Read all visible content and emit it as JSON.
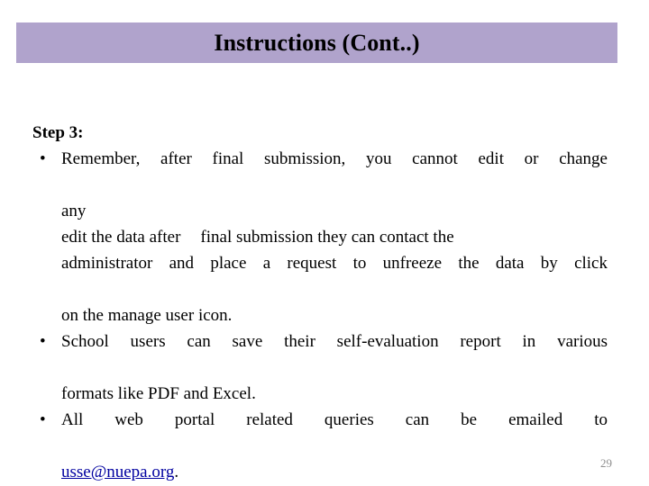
{
  "slide": {
    "title": "Instructions (Cont..)",
    "title_bar_color": "#b0a3cc",
    "background_color": "#ffffff",
    "page_number": "29"
  },
  "body": {
    "step_heading": "Step 3:",
    "bullets": [
      {
        "lines": [
          "Remember, after final submission, you cannot edit or change",
          "any",
          "edit the data after",
          "final submission they can contact the",
          "administrator and place a request to unfreeze the data by click",
          "on the manage user icon."
        ]
      },
      {
        "lines": [
          "School users can save their self-evaluation report in various",
          "formats like PDF and Excel."
        ]
      },
      {
        "lines": [
          "All web portal related queries can be emailed to"
        ],
        "link_text": "usse@nuepa.org",
        "link_color": "#0000a0",
        "trailing_text": "."
      }
    ],
    "bullet_glyph": "•"
  }
}
